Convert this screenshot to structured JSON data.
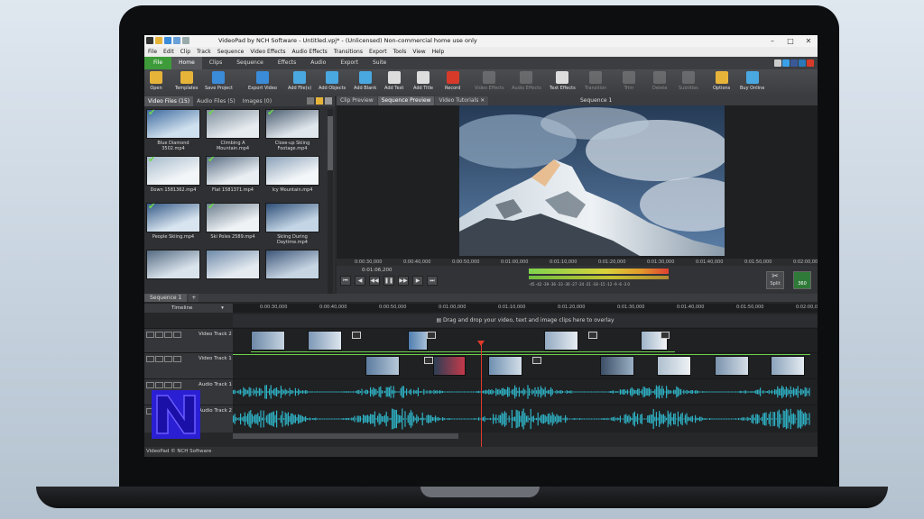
{
  "app": {
    "title": "VideoPad by NCH Software - Untitled.vpj* - (Unlicensed) Non-commercial home use only",
    "status": "VideoPad © NCH Software"
  },
  "menu": [
    "File",
    "Edit",
    "Clip",
    "Track",
    "Sequence",
    "Video Effects",
    "Audio Effects",
    "Transitions",
    "Export",
    "Tools",
    "View",
    "Help"
  ],
  "ribbon_tabs": [
    "File",
    "Home",
    "Clips",
    "Sequence",
    "Effects",
    "Audio",
    "Export",
    "Suite"
  ],
  "toolbar": [
    {
      "label": "Open",
      "color": "#e7b43a",
      "enabled": true
    },
    {
      "label": "Templates",
      "color": "#e7b43a",
      "enabled": true
    },
    {
      "label": "Save Project",
      "color": "#3a8bd8",
      "enabled": true
    },
    {
      "label": "Export Video",
      "color": "#3a8bd8",
      "enabled": true
    },
    {
      "label": "Add File(s)",
      "color": "#4aa8e0",
      "enabled": true
    },
    {
      "label": "Add Objects",
      "color": "#4aa8e0",
      "enabled": true
    },
    {
      "label": "Add Blank",
      "color": "#4aa8e0",
      "enabled": true
    },
    {
      "label": "Add Text",
      "color": "#dddddd",
      "enabled": true
    },
    {
      "label": "Add Title",
      "color": "#dddddd",
      "enabled": true
    },
    {
      "label": "Record",
      "color": "#d83a2a",
      "enabled": true
    },
    {
      "label": "Video Effects",
      "color": "#aaaaaa",
      "enabled": false
    },
    {
      "label": "Audio Effects",
      "color": "#aaaaaa",
      "enabled": false
    },
    {
      "label": "Text Effects",
      "color": "#dddddd",
      "enabled": true
    },
    {
      "label": "Transition",
      "color": "#aaaaaa",
      "enabled": false
    },
    {
      "label": "Trim",
      "color": "#aaaaaa",
      "enabled": false
    },
    {
      "label": "Delete",
      "color": "#aaaaaa",
      "enabled": false
    },
    {
      "label": "Subtitles",
      "color": "#aaaaaa",
      "enabled": false
    },
    {
      "label": "Options",
      "color": "#e7b43a",
      "enabled": true
    },
    {
      "label": "Buy Online",
      "color": "#4aa8e0",
      "enabled": true
    }
  ],
  "media": {
    "tabs": [
      {
        "label": "Video Files",
        "count": "(15)"
      },
      {
        "label": "Audio Files",
        "count": "(5)"
      },
      {
        "label": "Images",
        "count": "(0)"
      }
    ],
    "clips": [
      {
        "name": "Blue Diamond 3502.mp4",
        "checked": true
      },
      {
        "name": "Climbing A Mountain.mp4",
        "checked": true
      },
      {
        "name": "Close-up Skiing Footage.mp4",
        "checked": true
      },
      {
        "name": "Down 1581362.mp4",
        "checked": true
      },
      {
        "name": "Flat 1581371.mp4",
        "checked": true
      },
      {
        "name": "Icy Mountain.mp4",
        "checked": false
      },
      {
        "name": "People Skiing.mp4",
        "checked": true
      },
      {
        "name": "Ski Poles 2589.mp4",
        "checked": true
      },
      {
        "name": "Skiing During Daytime.mp4",
        "checked": false
      },
      {
        "name": "",
        "checked": false
      },
      {
        "name": "",
        "checked": false
      },
      {
        "name": "",
        "checked": false
      }
    ]
  },
  "preview": {
    "tabs": [
      "Clip Preview",
      "Sequence Preview",
      "Video Tutorials"
    ],
    "sequence_title": "Sequence 1",
    "ruler": [
      "0:00:30,000",
      "0:00:40,000",
      "0:00:50,000",
      "0:01:00,000",
      "0:01:10,000",
      "0:01:20,000",
      "0:01:30,000",
      "0:01:40,000",
      "0:01:50,000",
      "0:02:00,000"
    ],
    "timecode": "0:01:06,200",
    "meter_scale": "-45 -42 -39 -36 -33 -30 -27 -24 -21 -18 -15 -12 -9 -6 -3 0",
    "split_label": "Split",
    "label_360": "360"
  },
  "timeline": {
    "tab": "Sequence 1",
    "add": "+",
    "label": "Timeline",
    "ruler": [
      "0:00:30,000",
      "0:00:40,000",
      "0:00:50,000",
      "0:01:00,000",
      "0:01:10,000",
      "0:01:20,000",
      "0:01:30,000",
      "0:01:40,000",
      "0:01:50,000",
      "0:02:00,000"
    ],
    "overlay_hint": "Drag and drop your video, text and image clips here to overlay",
    "tracks": [
      "Video Track 2",
      "Video Track 1",
      "Audio Track 1",
      "Audio Track 2"
    ]
  },
  "colors": {
    "accent": "#3e9b3a",
    "waveform": "#2fb3c6",
    "playhead": "#e03a2a"
  }
}
